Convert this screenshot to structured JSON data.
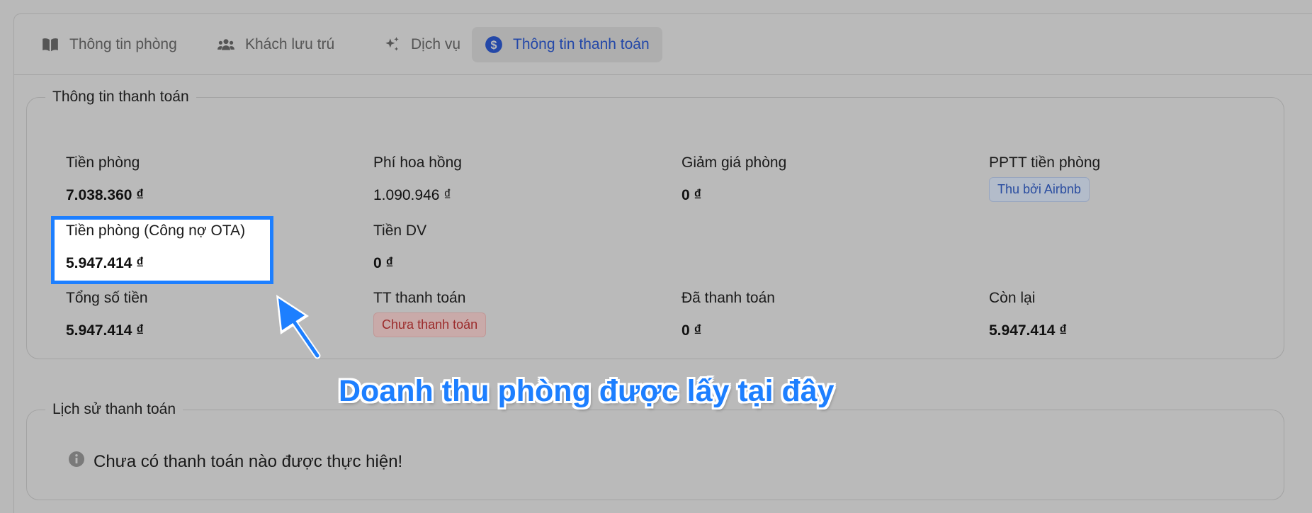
{
  "tabs": [
    {
      "label": "Thông tin phòng",
      "icon": "book-icon"
    },
    {
      "label": "Khách lưu trú",
      "icon": "users-icon"
    },
    {
      "label": "Dịch vụ",
      "icon": "sparkles-icon"
    },
    {
      "label": "Thông tin thanh toán",
      "icon": "dollar-circle-icon",
      "active": true
    }
  ],
  "payment": {
    "title": "Thông tin thanh toán",
    "room_fee": {
      "label": "Tiền phòng",
      "value": "7.038.360 ₫"
    },
    "commission": {
      "label": "Phí hoa hồng",
      "value": "1.090.946 ₫"
    },
    "room_discount": {
      "label": "Giảm giá phòng",
      "value": "0 ₫"
    },
    "room_payment_method": {
      "label": "PPTT tiền phòng",
      "value": "Thu bởi Airbnb"
    },
    "ota_debt": {
      "label": "Tiền phòng (Công nợ OTA)",
      "value": "5.947.414 ₫"
    },
    "service_fee": {
      "label": "Tiền DV",
      "value": "0 ₫"
    },
    "total": {
      "label": "Tổng số tiền",
      "value": "5.947.414 ₫"
    },
    "payment_status": {
      "label": "TT thanh toán",
      "value": "Chưa thanh toán"
    },
    "paid": {
      "label": "Đã thanh toán",
      "value": "0 ₫"
    },
    "remaining": {
      "label": "Còn lại",
      "value": "5.947.414 ₫"
    }
  },
  "history": {
    "title": "Lịch sử thanh toán",
    "empty_message": "Chưa có thanh toán nào được thực hiện!"
  },
  "annotation": {
    "callout": "Doanh thu phòng được lấy tại đây",
    "color": "#1d7fff"
  }
}
